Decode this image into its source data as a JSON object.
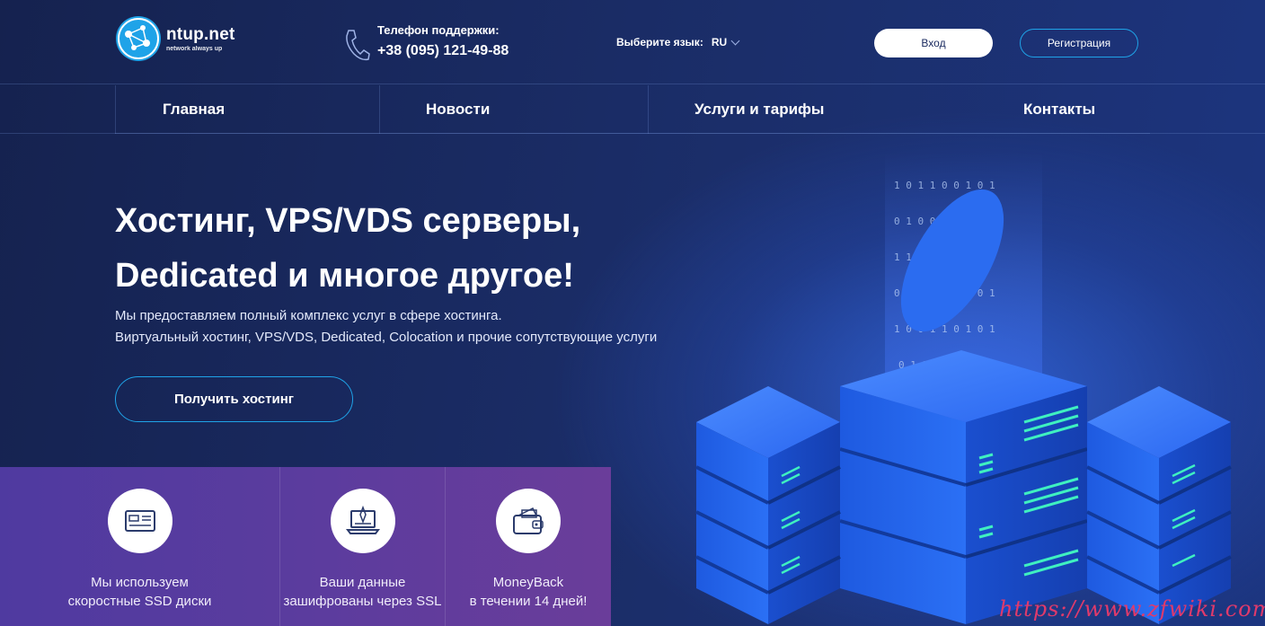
{
  "logo": {
    "name": "ntup.net",
    "tagline": "network always up"
  },
  "support": {
    "label": "Телефон поддержки:",
    "phone": "+38 (095) 121-49-88"
  },
  "language": {
    "label": "Выберите язык:",
    "value": "RU"
  },
  "auth": {
    "login": "Вход",
    "register": "Регистрация"
  },
  "nav": {
    "items": [
      "Главная",
      "Новости",
      "Услуги и тарифы",
      "Контакты"
    ]
  },
  "hero": {
    "title_line1": "Хостинг, VPS/VDS серверы,",
    "title_line2": "Dedicated и многое другое!",
    "sub_line1": "Мы предоставляем полный комплекс услуг в сфере хостинга.",
    "sub_line2": "Виртуальный хостинг, VPS/VDS, Dedicated, Colocation и прочие сопутствующие услуги",
    "cta": "Получить хостинг"
  },
  "features": [
    {
      "icon": "ssd-icon",
      "line1": "Мы используем",
      "line2": "скоростные SSD диски"
    },
    {
      "icon": "ssl-laptop-icon",
      "line1": "Ваши данные",
      "line2": "зашифрованы через SSL"
    },
    {
      "icon": "wallet-icon",
      "line1": "MoneyBack",
      "line2": "в течении 14 дней!"
    }
  ],
  "watermark": "https://www.zfwiki.com",
  "colors": {
    "accent": "#1fa3e8",
    "background": "#1b2e6a",
    "features_bg": "#5b3c9e",
    "server_blue": "#1e63e6"
  }
}
